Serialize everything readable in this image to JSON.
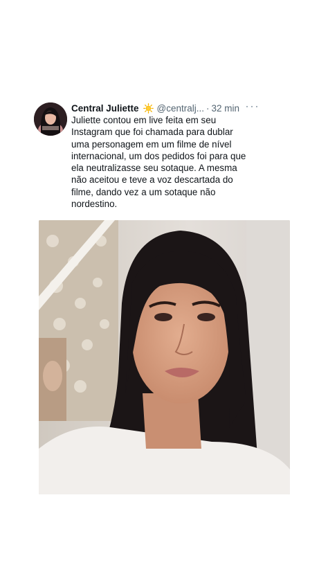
{
  "tweet": {
    "display_name": "Central Juliette",
    "verified_emoji": "sun-emoji",
    "handle": "@centralj...",
    "separator": "·",
    "timestamp": "32 min",
    "more_icon": "more-horizontal-icon",
    "text_lines": [
      "Juliette contou em live feita em seu",
      "Instagram que foi chamada para dublar",
      "uma personagem em um filme de nível",
      "internacional, um dos pedidos foi para que",
      "ela neutralizasse seu sotaque. A mesma",
      "não aceitou e teve a voz descartada do",
      "filme, dando vez a um sotaque não",
      "nordestino."
    ],
    "media": {
      "type": "video-still",
      "description_icon": "woman-portrait-image"
    }
  },
  "colors": {
    "text": "#0f1419",
    "secondary": "#536471",
    "background": "#ffffff"
  }
}
